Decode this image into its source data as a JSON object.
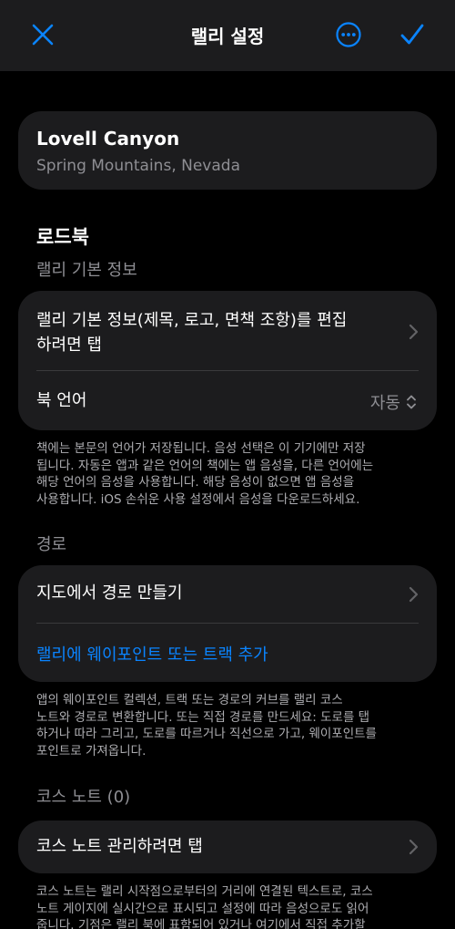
{
  "navbar": {
    "title": "랠리 설정"
  },
  "icons": {
    "close": "close-icon",
    "more": "ellipsis-circle-icon",
    "done": "checkmark-icon",
    "chevron": "chevron-right-icon",
    "updown": "chevron-up-down-icon"
  },
  "colors": {
    "accent": "#0a84ff",
    "background": "#000000",
    "card": "#1c1c1e",
    "secondary_text": "#8e8e93"
  },
  "location": {
    "name": "Lovell Canyon",
    "region": "Spring Mountains, Nevada"
  },
  "roadbook": {
    "title": "로드북",
    "subtitle": "랠리 기본 정보",
    "edit_row": "랠리 기본 정보(제목, 로고, 면책 조항)를 편집하려면 탭",
    "edit_row_line1": "랠리 기본 정보(제목, 로고, 면책 조항)를 편집",
    "edit_row_line2": "하려면 탭",
    "language_label": "북 언어",
    "language_value": "자동",
    "footnote_lines": [
      "책에는 본문의 언어가 저장됩니다. 음성 선택은 이 기기에만 저장",
      "됩니다. 자동은 앱과 같은 언어의 책에는 앱 음성을, 다른 언어에는",
      "해당 언어의 음성을 사용합니다. 해당 음성이 없으면 앱 음성을",
      "사용합니다. iOS 손쉬운 사용 설정에서 음성을 다운로드하세요."
    ]
  },
  "route": {
    "header": "경로",
    "create_row": "지도에서 경로 만들기",
    "add_link": "랠리에 웨이포인트 또는 트랙 추가",
    "footnote_lines": [
      "앱의 웨이포인트 컬렉션, 트랙 또는 경로의 커브를 랠리 코스",
      "노트와 경로로 변환합니다. 또는 직접 경로를 만드세요: 도로를 탭",
      "하거나 따라 그리고, 도로를 따르거나 직선으로 가고, 웨이포인트를",
      "포인트로 가져옵니다."
    ]
  },
  "course_notes": {
    "header": "코스 노트 (0)",
    "manage_row": "코스 노트 관리하려면 탭",
    "footnote_lines": [
      "코스 노트는 랠리 시작점으로부터의 거리에 연결된 텍스트로, 코스",
      "노트 게이지에 실시간으로 표시되고 설정에 따라 음성으로도 읽어",
      "줍니다. 기점은 랠리 북에 표함되어 있거나 여기에서 직접 추가할"
    ]
  }
}
